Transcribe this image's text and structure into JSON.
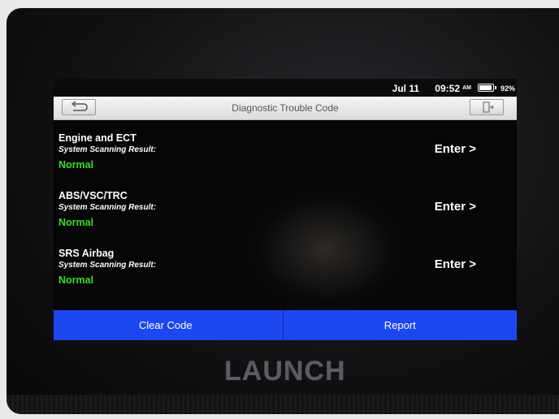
{
  "status_bar": {
    "date": "Jul 11",
    "time": "09:52",
    "ampm": "AM",
    "battery_percent": "92%",
    "battery_level": 0.92
  },
  "title_bar": {
    "title": "Diagnostic Trouble Code",
    "back_icon": "back-arrow-icon",
    "exit_icon": "exit-door-icon"
  },
  "systems": [
    {
      "name": "Engine and ECT",
      "label": "System Scanning Result:",
      "status": "Normal",
      "action": "Enter >"
    },
    {
      "name": "ABS/VSC/TRC",
      "label": "System Scanning Result:",
      "status": "Normal",
      "action": "Enter >"
    },
    {
      "name": "SRS Airbag",
      "label": "System Scanning Result:",
      "status": "Normal",
      "action": "Enter >"
    }
  ],
  "bottom_bar": {
    "clear_code": "Clear Code",
    "report": "Report"
  },
  "device": {
    "brand": "LAUNCH"
  },
  "colors": {
    "status_normal": "#3bdc27",
    "action_bar": "#1c47f0"
  }
}
